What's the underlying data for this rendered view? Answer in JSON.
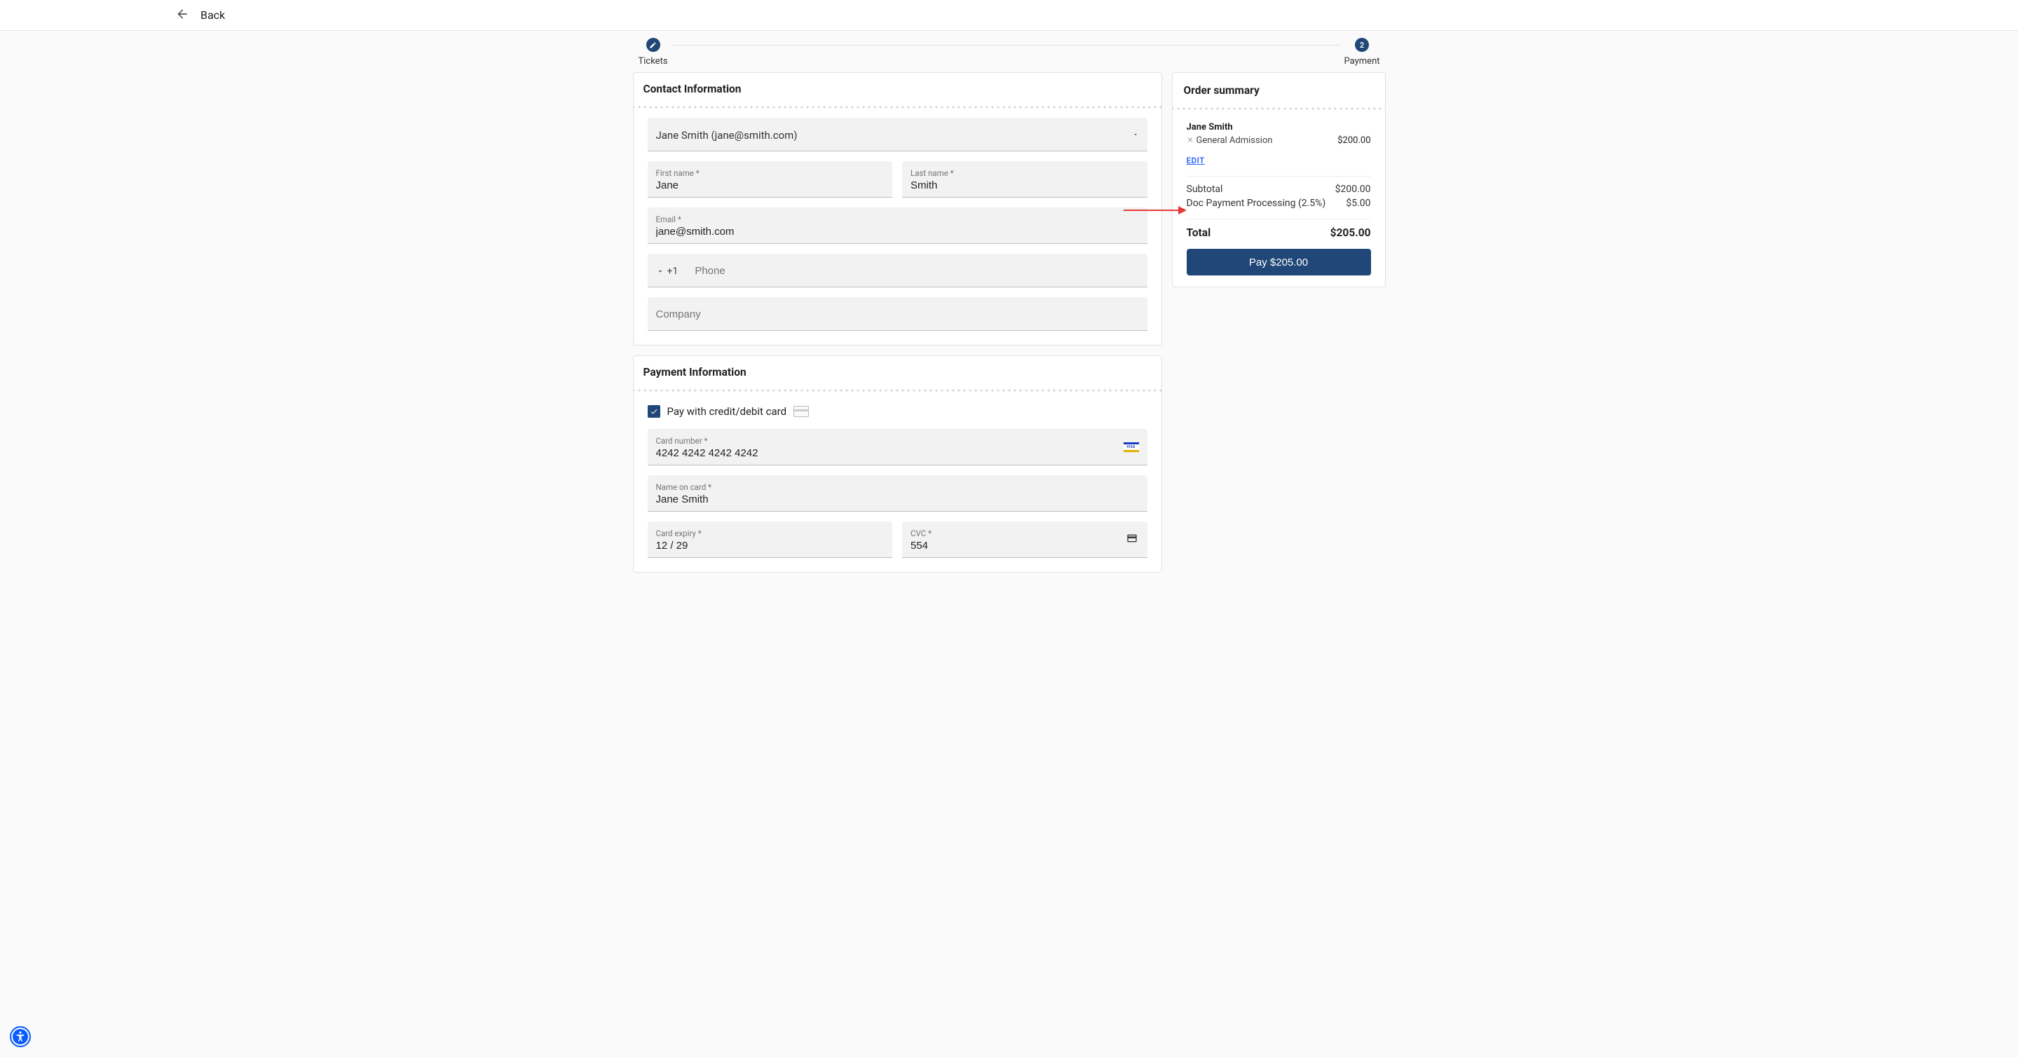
{
  "header": {
    "back_label": "Back"
  },
  "stepper": {
    "step1_label": "Tickets",
    "step2_number": "2",
    "step2_label": "Payment"
  },
  "contact": {
    "section_title": "Contact Information",
    "selector_value": "Jane Smith (jane@smith.com)",
    "first_name_label": "First name *",
    "first_name_value": "Jane",
    "last_name_label": "Last name *",
    "last_name_value": "Smith",
    "email_label": "Email *",
    "email_value": "jane@smith.com",
    "phone_cc": "+1",
    "phone_placeholder": "Phone",
    "phone_value": "",
    "company_placeholder": "Company",
    "company_value": ""
  },
  "payment": {
    "section_title": "Payment Information",
    "pay_with_card_label": "Pay with credit/debit card",
    "pay_with_card_checked": true,
    "card_number_label": "Card number *",
    "card_number_value": "4242 4242 4242 4242",
    "card_brand": "visa",
    "name_on_card_label": "Name on card *",
    "name_on_card_value": "Jane Smith",
    "card_expiry_label": "Card expiry *",
    "card_expiry_value": "12 / 29",
    "cvc_label": "CVC *",
    "cvc_value": "554"
  },
  "summary": {
    "title": "Order summary",
    "purchaser_name": "Jane Smith",
    "line_item_label": "General Admission",
    "line_item_price": "$200.00",
    "edit_label": "EDIT",
    "subtotal_label": "Subtotal",
    "subtotal_value": "$200.00",
    "fee_label": "Doc Payment Processing (2.5%)",
    "fee_value": "$5.00",
    "total_label": "Total",
    "total_value": "$205.00",
    "pay_button_label": "Pay $205.00"
  }
}
